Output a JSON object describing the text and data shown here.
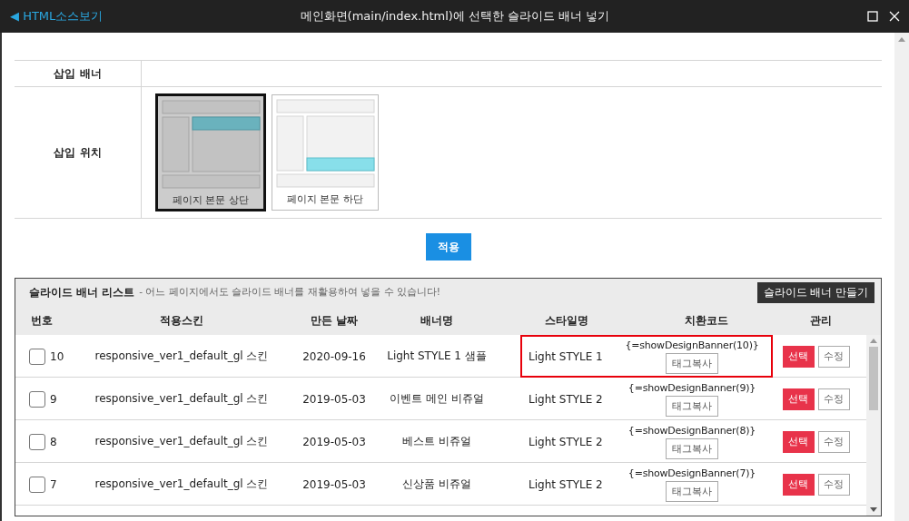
{
  "window": {
    "back_link": "◀ HTML소스보기",
    "title": "메인화면(main/index.html)에 선택한 슬라이드 배너 넣기"
  },
  "form": {
    "banner_label": "삽입 배너",
    "position_label": "삽입 위치",
    "positions": [
      {
        "kind": "top",
        "label": "페이지 본문 상단",
        "selected": true
      },
      {
        "kind": "bottom",
        "label": "페이지 본문 하단",
        "selected": false
      }
    ],
    "apply_button": "적용"
  },
  "list": {
    "title": "슬라이드 배너 리스트",
    "subtitle": "- 어느 페이지에서도 슬라이드 배너를 재활용하여 넣을 수 있습니다!",
    "create_button": "슬라이드 배너 만들기",
    "columns": [
      "번호",
      "적용스킨",
      "만든 날짜",
      "배너명",
      "스타일명",
      "치환코드",
      "관리"
    ],
    "rows": [
      {
        "checked": false,
        "number": "10",
        "skin": "responsive_ver1_default_gl 스킨",
        "date": "2020-09-16",
        "name": "Light STYLE 1 샘플",
        "style": "Light STYLE 1",
        "code": "{=showDesignBanner(10)}",
        "copy_button": "태그복사",
        "select_button": "선택",
        "edit_button": "수정",
        "highlighted": true
      },
      {
        "checked": false,
        "number": "9",
        "skin": "responsive_ver1_default_gl 스킨",
        "date": "2019-05-03",
        "name": "이벤트 메인 비쥬얼",
        "style": "Light STYLE 2",
        "code": "{=showDesignBanner(9)}",
        "copy_button": "태그복사",
        "select_button": "선택",
        "edit_button": "수정",
        "highlighted": false
      },
      {
        "checked": false,
        "number": "8",
        "skin": "responsive_ver1_default_gl 스킨",
        "date": "2019-05-03",
        "name": "베스트 비쥬얼",
        "style": "Light STYLE 2",
        "code": "{=showDesignBanner(8)}",
        "copy_button": "태그복사",
        "select_button": "선택",
        "edit_button": "수정",
        "highlighted": false
      },
      {
        "checked": false,
        "number": "7",
        "skin": "responsive_ver1_default_gl 스킨",
        "date": "2019-05-03",
        "name": "신상품 비쥬얼",
        "style": "Light STYLE 2",
        "code": "{=showDesignBanner(7)}",
        "copy_button": "태그복사",
        "select_button": "선택",
        "edit_button": "수정",
        "highlighted": false
      }
    ]
  }
}
